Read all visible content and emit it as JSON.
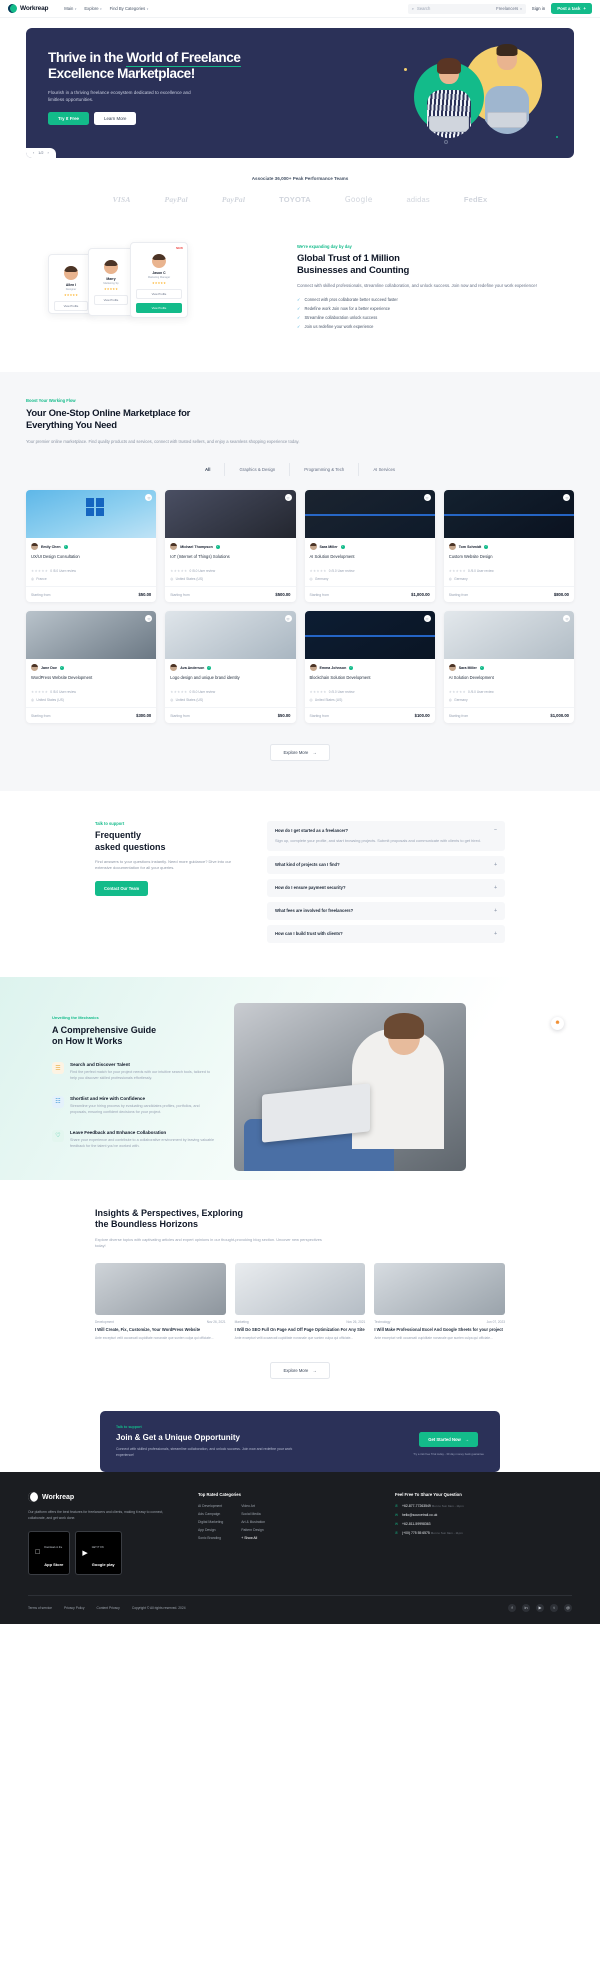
{
  "nav": {
    "brand": "Workreap",
    "links": [
      {
        "label": "Main",
        "caret": "▾"
      },
      {
        "label": "Explore",
        "caret": "▾"
      },
      {
        "label": "Find By Categories",
        "caret": "▾"
      }
    ],
    "search_placeholder": "Search",
    "search_icon": "search-icon",
    "search_scope": "Freelancers",
    "signin": "Sign in",
    "post_task": "Post a task",
    "post_task_icon": "+"
  },
  "hero": {
    "title_line1_a": "Thrive in the ",
    "title_line1_b": "World of Freelance",
    "title_line2": "Excellence Marketplace!",
    "subtitle": "Flourish in a thriving freelance ecosystem dedicated to excellence and limitless opportunities.",
    "btn_primary": "Try It Free",
    "btn_secondary": "Learn More",
    "slide_prev": "‹",
    "slide_counter": "1/2",
    "slide_next": "›"
  },
  "brands": {
    "title": "Associate 36,000+ Peak Performance Teams",
    "logos": [
      "VISA",
      "PayPal",
      "PayPal",
      "TOYOTA",
      "Google",
      "adidas",
      "FedEx"
    ]
  },
  "trust": {
    "eyebrow": "We're expanding day by day",
    "heading_line1": "Global Trust of 1 Million",
    "heading_line2": "Businesses and Counting",
    "paragraph": "Connect with skilled professionals, streamline collaboration, and unlock success. Join now and redefine your work experience!",
    "bullets": [
      "Connect with pros collaborate better succeed faster",
      "Redefine work Join now for a better experience",
      "Streamline collaboration unlock success",
      "Join us redefine your work experience"
    ],
    "cards": [
      {
        "badge": "",
        "name": "Allen I",
        "role": "Designer",
        "stars": "★★★★★",
        "action": "View Profile"
      },
      {
        "badge": "",
        "name": "Marry",
        "role": "Marketing Sp",
        "stars": "★★★★★",
        "action": "View Profile"
      },
      {
        "badge": "NEW",
        "name": "Jason C",
        "role": "Marketing Manager",
        "stars": "★★★★★",
        "action": "View Profile"
      }
    ]
  },
  "market": {
    "eyebrow": "Boost Your Working Flow",
    "heading_line1": "Your One-Stop Online Marketplace for",
    "heading_line2": "Everything You Need",
    "paragraph": "Your premier online marketplace. Find quality products and services, connect with trusted sellers, and enjoy a seamless shopping experience today.",
    "tabs": [
      "All",
      "Graphics & Design",
      "Programming & Tech",
      "AI Services"
    ],
    "active_tab": "All",
    "rating_text": "0 /5.0 User review",
    "starting_label": "Starting from",
    "stars": "★★★★★",
    "explore_label": "Explore More",
    "explore_icon": "→",
    "cards": [
      {
        "user": "Emily Chen",
        "title": "UX/UI Design Consultation",
        "location": "France",
        "price": "$50.00",
        "img": "img-a"
      },
      {
        "user": "Michael Thompson",
        "title": "IoT (Internet of Things) Solutions",
        "location": "United States (US)",
        "price": "$500.00",
        "img": "img-b"
      },
      {
        "user": "Sara Miller",
        "title": "AI Solution Development",
        "location": "Germany",
        "price": "$1,000.00",
        "img": "img-c"
      },
      {
        "user": "Tom Schmidt",
        "title": "Custom Website Design",
        "location": "Germany",
        "price": "$800.00",
        "img": "img-d"
      },
      {
        "user": "Jane Doe",
        "title": "WordPress Website Development",
        "location": "United States (US)",
        "price": "$300.00",
        "img": "img-e"
      },
      {
        "user": "Ava Anderson",
        "title": "Logo design and unique brand identity",
        "location": "United States (US)",
        "price": "$50.00",
        "img": "img-f"
      },
      {
        "user": "Emma Johnson",
        "title": "Blockchain Solution Development",
        "location": "United States (US)",
        "price": "$100.00",
        "img": "img-g"
      },
      {
        "user": "Sara Miller",
        "title": "AI Solution Development",
        "location": "Germany",
        "price": "$1,000.00",
        "img": "img-h"
      }
    ]
  },
  "faq": {
    "eyebrow": "Talk to support",
    "heading_line1": "Frequently",
    "heading_line2": "asked questions",
    "paragraph": "Find answers to your questions instantly. Need more guidance? Dive into our extensive documentation for all your queries.",
    "button": "Contact Our Team",
    "items": [
      {
        "q": "How do I get started as a freelancer?",
        "sign": "−",
        "a": "Sign up, complete your profile, and start browsing projects. Submit proposals and communicate with clients to get hired.",
        "open": true
      },
      {
        "q": "What kind of projects can I find?",
        "sign": "+",
        "a": "",
        "open": false
      },
      {
        "q": "How do I ensure payment security?",
        "sign": "+",
        "a": "",
        "open": false
      },
      {
        "q": "What fees are involved for freelancers?",
        "sign": "+",
        "a": "",
        "open": false
      },
      {
        "q": "How can I build trust with clients?",
        "sign": "+",
        "a": "",
        "open": false
      }
    ]
  },
  "how": {
    "eyebrow": "Unveiling the Mechanics",
    "heading_line1": "A Comprehensive Guide",
    "heading_line2": "on How It Works",
    "steps": [
      {
        "icon": "search-talent-icon",
        "glyph": "☰",
        "title": "Search and Discover Talent",
        "text": "Find the perfect match for your project needs with our intuitive search tools, tailored to help you discover skilled professionals effortlessly."
      },
      {
        "icon": "shortlist-hire-icon",
        "glyph": "☷",
        "title": "Shortlist and Hire with Confidence",
        "text": "Streamline your hiring process by evaluating candidates profiles, portfolios, and proposals, ensuring confident decisions for your project."
      },
      {
        "icon": "feedback-icon",
        "glyph": "♡",
        "title": "Leave Feedback and Enhance Collaboration",
        "text": "Share your experience and contribute to a collaborative environment by leaving valuable feedback for the talent you've worked with."
      }
    ],
    "chat_icon": "chat-support-icon",
    "chat_glyph": "☻"
  },
  "blog": {
    "heading_line1": "Insights & Perspectives, Exploring",
    "heading_line2": "the Boundless Horizons",
    "paragraph": "Explore diverse topics with captivating articles and expert opinions in our thought-provoking blog section. Uncover new perspectives today!",
    "posts": [
      {
        "cat": "Development",
        "date": "Nov 26, 2021",
        "title": "I Will Create, Fix, Customize, Your WordPress Website",
        "excerpt": "Ante excepturi velit occaecati cupiditate nonanale que sunten culpa qui officiate...",
        "img": "bi1"
      },
      {
        "cat": "Marketing",
        "date": "Nov 26, 2021",
        "title": "I Will Do SEO Full On Page And Off Page Optimization For Any Site",
        "excerpt": "Ante excepturi velit occaecati cupiditate nonanale que sunten culpa qui officiate...",
        "img": "bi2"
      },
      {
        "cat": "Technology",
        "date": "Jun 07, 2023",
        "title": "I Will Make Professional Excel And Google Sheets for your project",
        "excerpt": "Ante excepturi velit occaecati cupiditate nonanale que sunten culpa qui officiate...",
        "img": "bi3"
      }
    ],
    "explore_label": "Explore More",
    "explore_icon": "→"
  },
  "cta": {
    "eyebrow": "Talk to support",
    "heading": "Join & Get a Unique Opportunity",
    "paragraph": "Connect with skilled professionals, streamline collaboration, and unlock success. Join now and redefine your work experience!",
    "button": "Get Started Now",
    "button_icon": "→",
    "note": "Try a risk free Trial today - 30 day money back guarantee"
  },
  "footer": {
    "brand": "Workreap",
    "description": "Our platform offers the best features for freelancers and clients, making it easy to connect, collaborate, and get work done.",
    "stores": [
      {
        "icon": "apple-icon",
        "glyph": "",
        "line1": "Download on the",
        "line2": "App Store"
      },
      {
        "icon": "google-play-icon",
        "glyph": "▶",
        "line1": "GET IT ON",
        "line2": "Google play"
      }
    ],
    "categories_title": "Top Rated Categories",
    "categories_col1": [
      "AI Development",
      "Ads Campaign",
      "Digital Marketing",
      "App Design",
      "Sonic Branding"
    ],
    "categories_col2": [
      "Video Art",
      "Social Media",
      "Art & Illustration",
      "Pattern Design",
      "+ Show All"
    ],
    "contact_title": "Feel Free To Share Your Question",
    "contact": [
      {
        "icon": "phone-icon",
        "glyph": "✆",
        "value": "+62-877-77263549",
        "hours": "Mon to Sun 9am - 11pm"
      },
      {
        "icon": "mail-icon",
        "glyph": "✉",
        "value": "hello@sourcetrail.co.uk",
        "hours": ""
      },
      {
        "icon": "mail-icon",
        "glyph": "✉",
        "value": "+62-811-59998363",
        "hours": ""
      },
      {
        "icon": "phone-icon",
        "glyph": "✆",
        "value": "(+00) 775 55 6575",
        "hours": "Mon to Sun 9am - 11pm"
      }
    ],
    "bottom_links": [
      "Terms of service",
      "Privacy Policy",
      "Content Privacy"
    ],
    "copyright": "Copyright © All rights reserved. 2024",
    "socials": [
      "f",
      "in",
      "▶",
      "t",
      "@"
    ]
  }
}
